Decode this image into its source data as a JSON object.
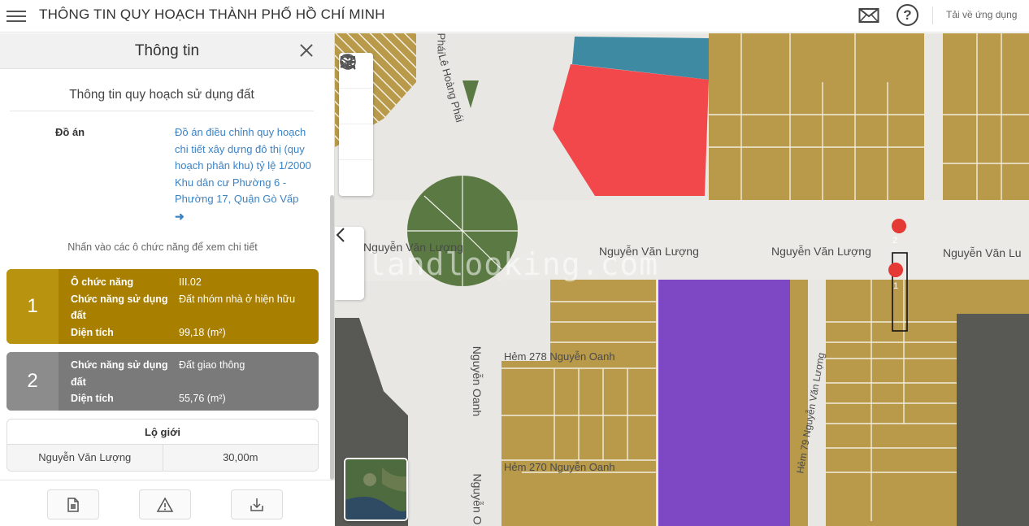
{
  "header": {
    "title": "THÔNG TIN QUY HOẠCH THÀNH PHỐ HỒ CHÍ MINH",
    "help_glyph": "?",
    "download_app": "Tải về ứng dụng"
  },
  "panel": {
    "title": "Thông tin",
    "section_title": "Thông tin quy hoạch sử dụng đất",
    "doan_label": "Đồ án",
    "doan_text": "Đồ án điều chỉnh quy hoạch chi tiết xây dựng đô thị (quy hoạch phân khu) tỷ lệ 1/2000 Khu dân cư Phường 6 - Phường 17, Quận Gò Vấp",
    "doan_arrow": "➜",
    "hint": "Nhấn vào các ô chức năng để xem chi tiết",
    "cards": [
      {
        "num": "1",
        "color": "#a97f00",
        "rows": [
          {
            "k": "Ô chức năng",
            "v": "III.02"
          },
          {
            "k": "Chức năng sử dụng đất",
            "v": "Đất nhóm nhà ở hiện hữu"
          },
          {
            "k": "Diện tích",
            "v": "99,18 (m²)"
          }
        ]
      },
      {
        "num": "2",
        "color": "#7a7a7a",
        "rows": [
          {
            "k": "Chức năng sử dụng đất",
            "v": "Đất giao thông"
          },
          {
            "k": "Diện tích",
            "v": "55,76 (m²)"
          }
        ]
      }
    ],
    "logioi": {
      "header": "Lộ giới",
      "street": "Nguyễn Văn Lượng",
      "width": "30,00m"
    }
  },
  "map": {
    "watermark": "landlooking.com",
    "streets": {
      "nvl_left": "Nguyễn Văn Lượng",
      "nvl_mid1": "Nguyễn Văn Lượng",
      "nvl_mid2": "Nguyễn Văn Lượng",
      "nvl_right": "Nguyễn Văn Lu",
      "le_hoang_phai": "Lê Hoàng Phái",
      "phai": "Phái",
      "nguyen_oanh": "Nguyễn Oanh",
      "nguyen_oanh2": "Nguyễn O",
      "hem278": "Hẻm 278 Nguyễn Oanh",
      "hem270": "Hẻm 270 Nguyễn Oanh",
      "hem_nvl": "Hẻm 79 Nguyễn Văn Lượng"
    },
    "markers": [
      "1",
      "2"
    ],
    "colors": {
      "residential": "#b89a4a",
      "road": "#e8e7e4",
      "commercial": "#f2484b",
      "purple": "#7e47c3",
      "green": "#5b7a43",
      "teal": "#3f8aa3",
      "dark": "#585854"
    }
  }
}
